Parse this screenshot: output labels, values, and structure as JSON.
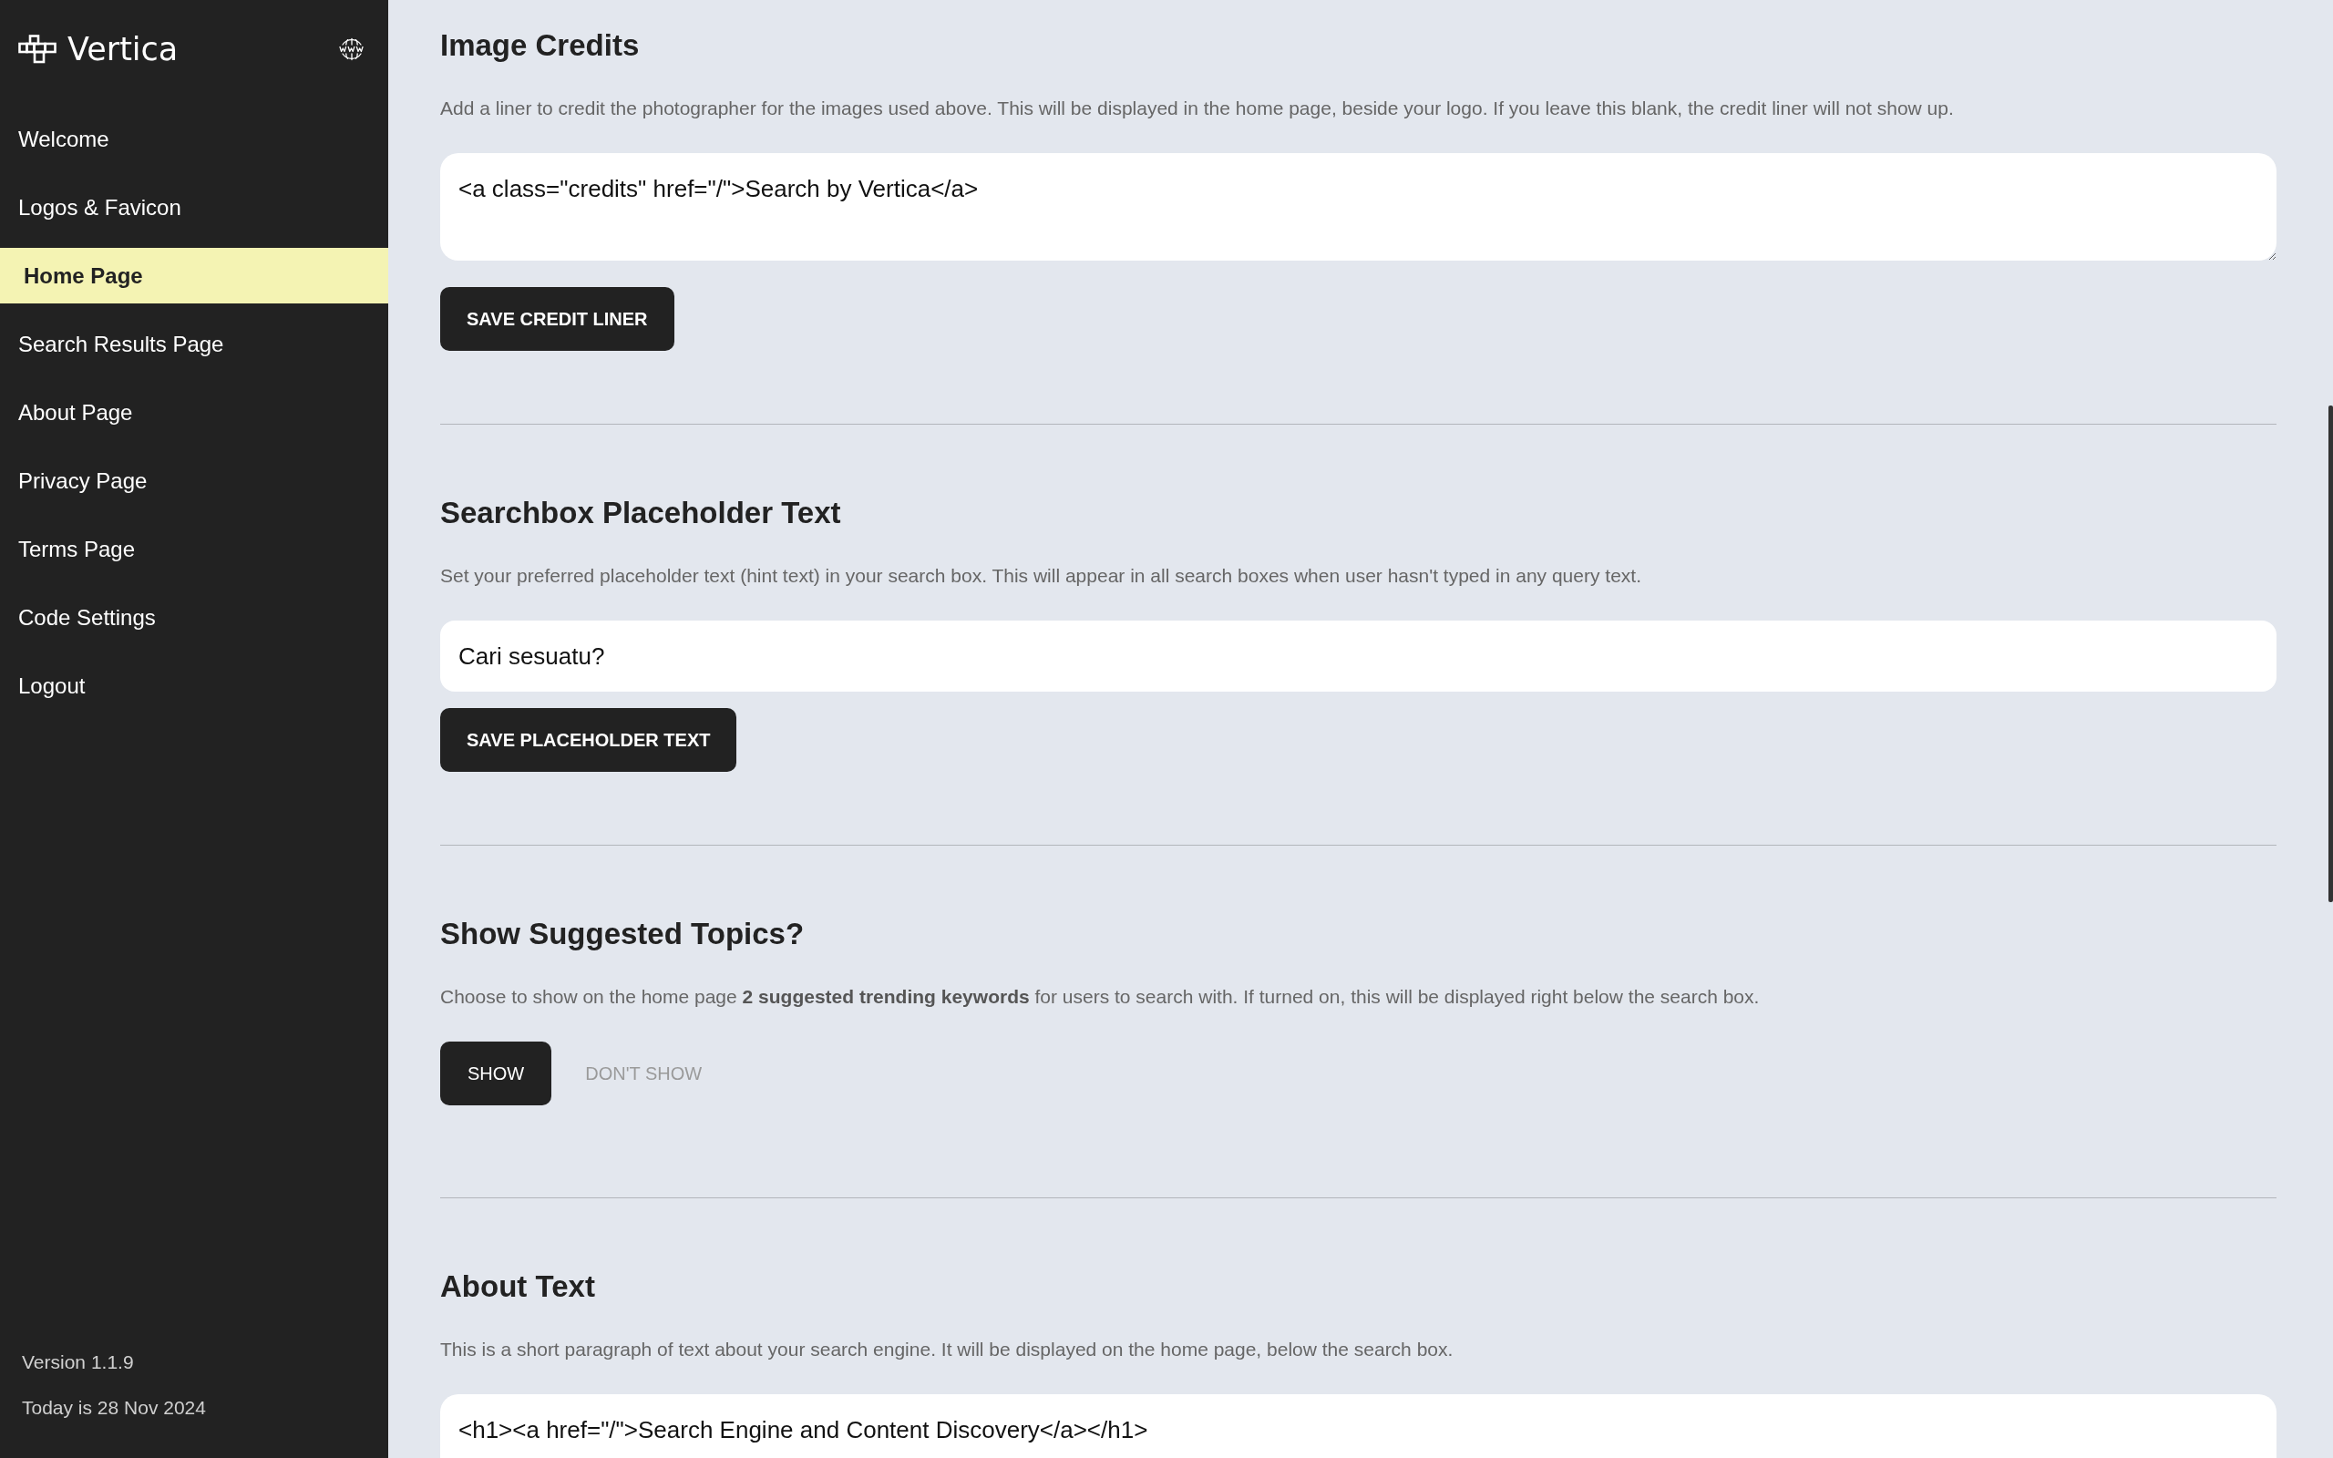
{
  "sidebar": {
    "logo": {
      "text": "Vertica"
    },
    "nav_items": [
      {
        "label": "Welcome",
        "selected": false
      },
      {
        "label": "Logos & Favicon",
        "selected": false
      },
      {
        "label": "Home Page",
        "selected": true
      },
      {
        "label": "Search Results Page",
        "selected": false
      },
      {
        "label": "About Page",
        "selected": false
      },
      {
        "label": "Privacy Page",
        "selected": false
      },
      {
        "label": "Terms Page",
        "selected": false
      },
      {
        "label": "Code Settings",
        "selected": false
      },
      {
        "label": "Logout",
        "selected": false
      }
    ],
    "footer": [
      "Version 1.1.9",
      "Today is 28 Nov 2024"
    ]
  },
  "sections": [
    {
      "kind": "textarea",
      "title": "Image Credits",
      "description": "Add a liner to credit the photographer for the images used above. This will be displayed in the home page, beside your logo. If you leave this blank, the credit liner will not show up.",
      "value": "<a class=\"credits\" href=\"/\">Search by Vertica</a>",
      "button": "SAVE CREDIT LINER"
    },
    {
      "kind": "input",
      "title": "Searchbox Placeholder Text",
      "description": "Set your preferred placeholder text (hint text) in your search box. This will appear in all search boxes when user hasn't typed in any query text.",
      "value": "Cari sesuatu?",
      "button": "SAVE PLACEHOLDER TEXT"
    },
    {
      "kind": "toggle",
      "title": "Show Suggested Topics?",
      "description": "Choose to show on the home page **2 suggested trending keywords** for users to search with. If turned on, this will be displayed right below the search box.",
      "options": [
        {
          "label": "SHOW",
          "selected": true
        },
        {
          "label": "DON'T SHOW",
          "selected": false
        }
      ]
    },
    {
      "kind": "textarea",
      "title": "About Text",
      "description": "This is a short paragraph of text about your search engine. It will be displayed on the home page, below the search box.",
      "value": "<h1><a href=\"/\">Search Engine and Content Discovery</a></h1>"
    }
  ]
}
